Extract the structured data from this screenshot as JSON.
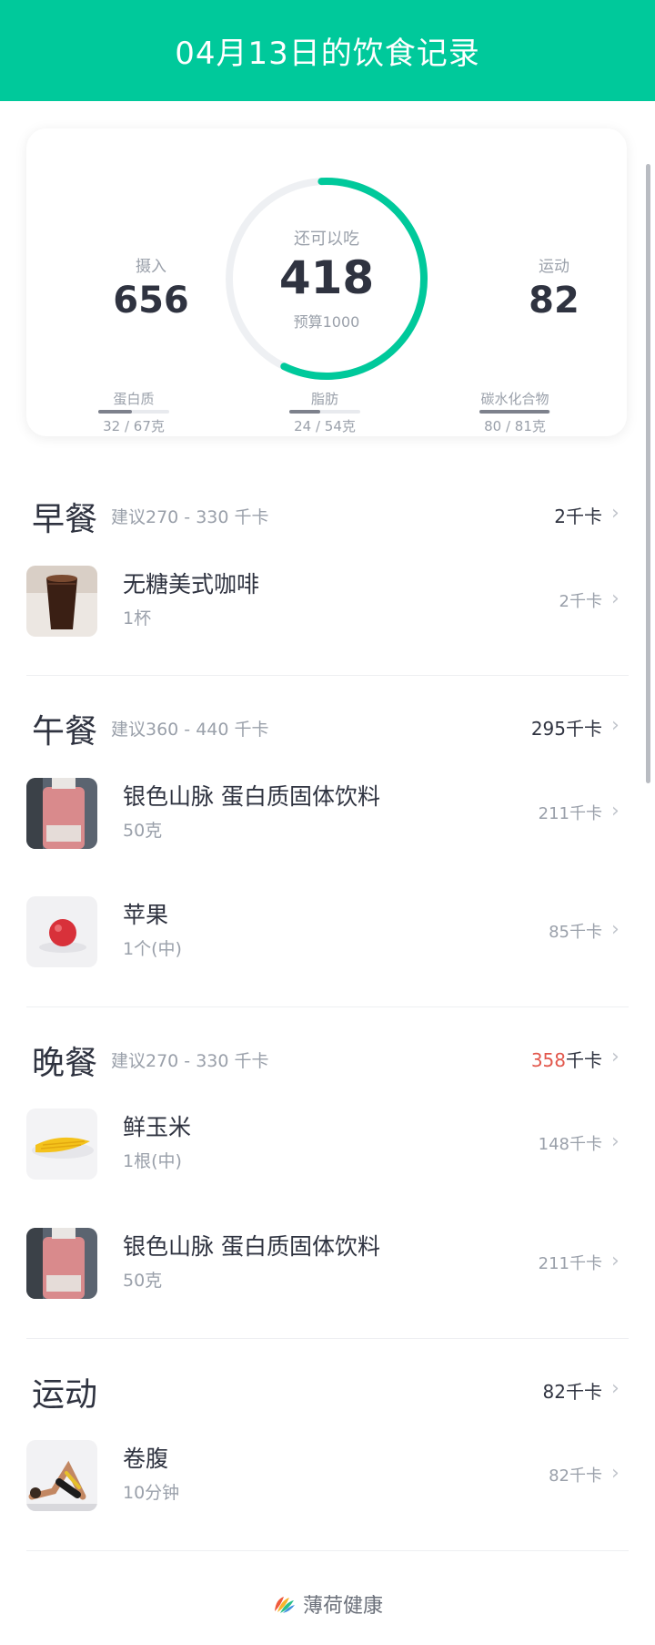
{
  "header": {
    "title": "04月13日的饮食记录"
  },
  "summary": {
    "intake_label": "摄入",
    "intake_value": "656",
    "exercise_label": "运动",
    "exercise_value": "82",
    "remaining_label": "还可以吃",
    "remaining_value": "418",
    "budget_label": "预算1000",
    "ring_progress": 0.58,
    "ring_color": "#00c99b",
    "macros": [
      {
        "name": "蛋白质",
        "value": "32 / 67克",
        "fill": 0.48
      },
      {
        "name": "脂肪",
        "value": "24 / 54克",
        "fill": 0.44
      },
      {
        "name": "碳水化合物",
        "value": "80 / 81克",
        "fill": 0.99
      }
    ]
  },
  "breakfast": {
    "title": "早餐",
    "hint": "建议270 - 330 千卡",
    "kcal": "2千卡",
    "items": [
      {
        "name": "无糖美式咖啡",
        "amount": "1杯",
        "kcal": "2千卡",
        "image": "coffee"
      }
    ]
  },
  "lunch": {
    "title": "午餐",
    "hint": "建议360 - 440 千卡",
    "kcal": "295千卡",
    "items": [
      {
        "name": "银色山脉 蛋白质固体饮料",
        "amount": "50克",
        "kcal": "211千卡",
        "image": "drink-bottle"
      },
      {
        "name": "苹果",
        "amount": "1个(中)",
        "kcal": "85千卡",
        "image": "apple"
      }
    ]
  },
  "dinner": {
    "title": "晚餐",
    "hint": "建议270 - 330 千卡",
    "kcal_number": "358",
    "kcal_unit": "千卡",
    "over_color": "#e2574c",
    "items": [
      {
        "name": "鲜玉米",
        "amount": "1根(中)",
        "kcal": "148千卡",
        "image": "corn"
      },
      {
        "name": "银色山脉 蛋白质固体饮料",
        "amount": "50克",
        "kcal": "211千卡",
        "image": "drink-bottle"
      }
    ]
  },
  "exercise": {
    "title": "运动",
    "kcal": "82千卡",
    "items": [
      {
        "name": "卷腹",
        "amount": "10分钟",
        "kcal": "82千卡",
        "image": "crunch"
      }
    ]
  },
  "footer": {
    "brand": "薄荷健康",
    "logo": "mint-leaf-logo"
  }
}
